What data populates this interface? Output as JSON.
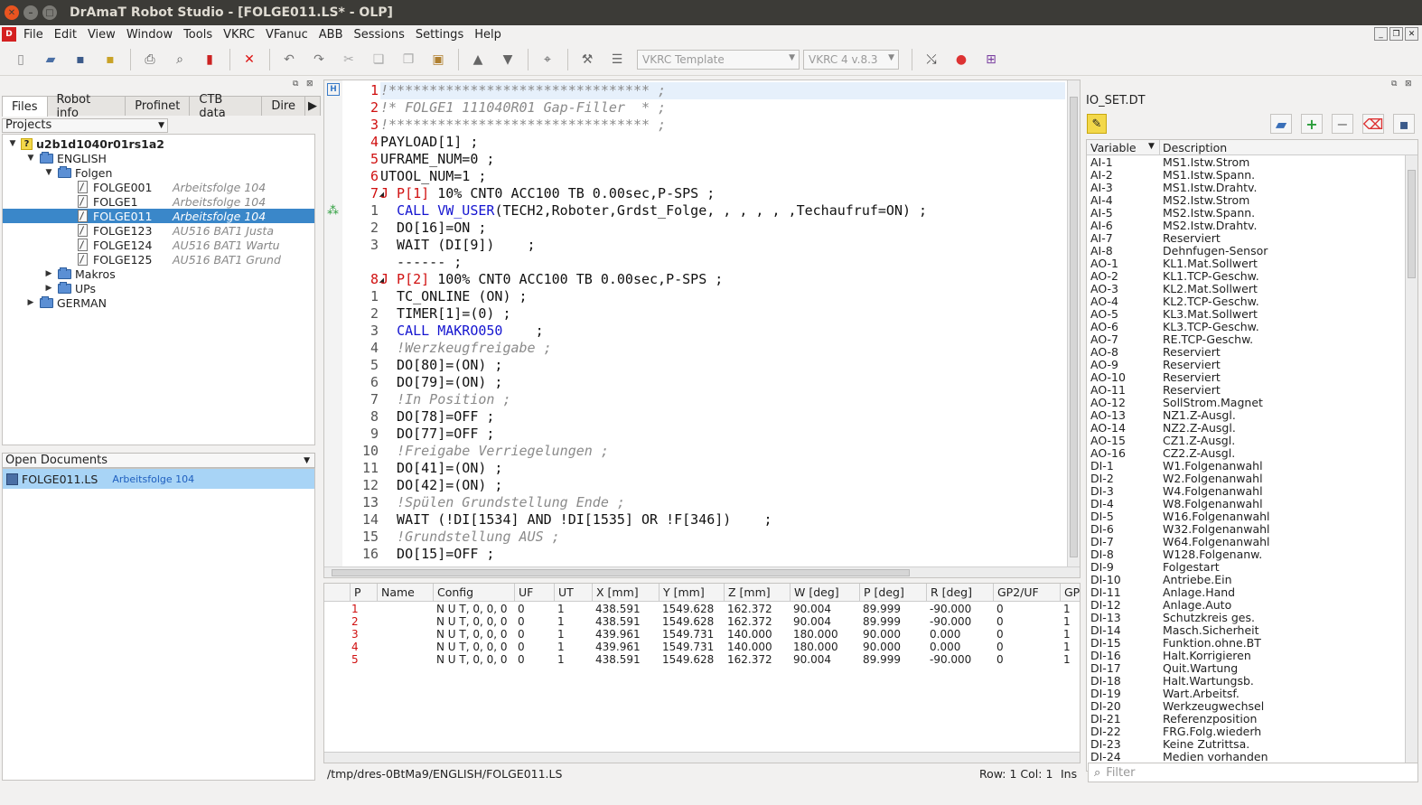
{
  "window": {
    "title": "DrAmaT Robot Studio - [FOLGE011.LS* - OLP]"
  },
  "menu": [
    "File",
    "Edit",
    "View",
    "Window",
    "Tools",
    "VKRC",
    "VFanuc",
    "ABB",
    "Sessions",
    "Settings",
    "Help"
  ],
  "toolbar": {
    "template_combo": "VKRC Template",
    "version_combo": "VKRC 4 v.8.3"
  },
  "left": {
    "tabs": [
      "Files",
      "Robot info",
      "Profinet",
      "CTB data",
      "Dire"
    ],
    "projects_label": "Projects",
    "tree": [
      {
        "label": "u2b1d1040r01rs1a2",
        "desc": "",
        "level": 0,
        "bold": true,
        "kind": "project",
        "expanded": true
      },
      {
        "label": "ENGLISH",
        "desc": "",
        "level": 1,
        "kind": "folder",
        "expanded": true
      },
      {
        "label": "Folgen",
        "desc": "",
        "level": 2,
        "kind": "folder",
        "expanded": true
      },
      {
        "label": "FOLGE001",
        "desc": "Arbeitsfolge 104",
        "level": 3,
        "kind": "file"
      },
      {
        "label": "FOLGE1",
        "desc": "Arbeitsfolge 104",
        "level": 3,
        "kind": "file"
      },
      {
        "label": "FOLGE011",
        "desc": "Arbeitsfolge 104",
        "level": 3,
        "kind": "file",
        "selected": true
      },
      {
        "label": "FOLGE123",
        "desc": "AU516 BAT1 Justa",
        "level": 3,
        "kind": "file"
      },
      {
        "label": "FOLGE124",
        "desc": "AU516 BAT1 Wartu",
        "level": 3,
        "kind": "file"
      },
      {
        "label": "FOLGE125",
        "desc": "AU516 BAT1 Grund",
        "level": 3,
        "kind": "file"
      },
      {
        "label": "Makros",
        "desc": "",
        "level": 2,
        "kind": "folder",
        "expanded": false
      },
      {
        "label": "UPs",
        "desc": "",
        "level": 2,
        "kind": "folder",
        "expanded": false
      },
      {
        "label": "GERMAN",
        "desc": "",
        "level": 1,
        "kind": "folder",
        "expanded": false
      }
    ],
    "open_documents_label": "Open Documents",
    "open_documents": [
      {
        "name": "FOLGE011.LS",
        "desc": "Arbeitsfolge 104"
      }
    ]
  },
  "editor": {
    "lines": [
      {
        "n": "1",
        "red": true,
        "parts": [
          {
            "t": "!******************************** ;",
            "c": "cmt"
          }
        ]
      },
      {
        "n": "2",
        "red": true,
        "parts": [
          {
            "t": "!* FOLGE1 111040R01 Gap-Filler  * ;",
            "c": "cmt"
          }
        ]
      },
      {
        "n": "3",
        "red": true,
        "parts": [
          {
            "t": "!******************************** ;",
            "c": "cmt"
          }
        ]
      },
      {
        "n": "4",
        "red": true,
        "parts": [
          {
            "t": "PAYLOAD[1] ;",
            "c": ""
          }
        ]
      },
      {
        "n": "5",
        "red": true,
        "parts": [
          {
            "t": "UFRAME_NUM=0 ;",
            "c": ""
          }
        ]
      },
      {
        "n": "6",
        "red": true,
        "parts": [
          {
            "t": "UTOOL_NUM=1 ;",
            "c": ""
          }
        ]
      },
      {
        "n": "7",
        "red": true,
        "fold": true,
        "parts": [
          {
            "t": "J P[1]",
            "c": "jmp"
          },
          {
            "t": " 10% CNT0 ACC100 TB 0.00sec,P-SPS ;",
            "c": ""
          }
        ]
      },
      {
        "n": "1",
        "red": false,
        "parts": [
          {
            "t": "  ",
            "c": ""
          },
          {
            "t": "CALL VW_USER",
            "c": "kw"
          },
          {
            "t": "(TECH2,Roboter,Grdst_Folge, , , , , ,Techaufruf=ON) ;",
            "c": ""
          }
        ]
      },
      {
        "n": "2",
        "red": false,
        "parts": [
          {
            "t": "  DO[16]=ON ;",
            "c": ""
          }
        ]
      },
      {
        "n": "3",
        "red": false,
        "parts": [
          {
            "t": "  WAIT (DI[9])    ;",
            "c": ""
          }
        ]
      },
      {
        "n": "",
        "red": false,
        "parts": [
          {
            "t": "  ------ ;",
            "c": ""
          }
        ]
      },
      {
        "n": "8",
        "red": true,
        "fold": true,
        "parts": [
          {
            "t": "J P[2]",
            "c": "jmp"
          },
          {
            "t": " 100% CNT0 ACC100 TB 0.00sec,P-SPS ;",
            "c": ""
          }
        ]
      },
      {
        "n": "1",
        "red": false,
        "parts": [
          {
            "t": "  TC_ONLINE (ON) ;",
            "c": ""
          }
        ]
      },
      {
        "n": "2",
        "red": false,
        "parts": [
          {
            "t": "  TIMER[1]=(0) ;",
            "c": ""
          }
        ]
      },
      {
        "n": "3",
        "red": false,
        "parts": [
          {
            "t": "  ",
            "c": ""
          },
          {
            "t": "CALL MAKRO050",
            "c": "kw"
          },
          {
            "t": "    ;",
            "c": ""
          }
        ]
      },
      {
        "n": "4",
        "red": false,
        "parts": [
          {
            "t": "  ",
            "c": ""
          },
          {
            "t": "!Werzkeugfreigabe ;",
            "c": "cmt"
          }
        ]
      },
      {
        "n": "5",
        "red": false,
        "parts": [
          {
            "t": "  DO[80]=(ON) ;",
            "c": ""
          }
        ]
      },
      {
        "n": "6",
        "red": false,
        "parts": [
          {
            "t": "  DO[79]=(ON) ;",
            "c": ""
          }
        ]
      },
      {
        "n": "7",
        "red": false,
        "parts": [
          {
            "t": "  ",
            "c": ""
          },
          {
            "t": "!In Position ;",
            "c": "cmt"
          }
        ]
      },
      {
        "n": "8",
        "red": false,
        "parts": [
          {
            "t": "  DO[78]=OFF ;",
            "c": ""
          }
        ]
      },
      {
        "n": "9",
        "red": false,
        "parts": [
          {
            "t": "  DO[77]=OFF ;",
            "c": ""
          }
        ]
      },
      {
        "n": "10",
        "red": false,
        "parts": [
          {
            "t": "  ",
            "c": ""
          },
          {
            "t": "!Freigabe Verriegelungen ;",
            "c": "cmt"
          }
        ]
      },
      {
        "n": "11",
        "red": false,
        "parts": [
          {
            "t": "  DO[41]=(ON) ;",
            "c": ""
          }
        ]
      },
      {
        "n": "12",
        "red": false,
        "parts": [
          {
            "t": "  DO[42]=(ON) ;",
            "c": ""
          }
        ]
      },
      {
        "n": "13",
        "red": false,
        "parts": [
          {
            "t": "  ",
            "c": ""
          },
          {
            "t": "!Spülen Grundstellung Ende ;",
            "c": "cmt"
          }
        ]
      },
      {
        "n": "14",
        "red": false,
        "parts": [
          {
            "t": "  WAIT (!DI[1534] AND !DI[1535] OR !F[346])    ;",
            "c": ""
          }
        ]
      },
      {
        "n": "15",
        "red": false,
        "parts": [
          {
            "t": "  ",
            "c": ""
          },
          {
            "t": "!Grundstellung AUS ;",
            "c": "cmt"
          }
        ]
      },
      {
        "n": "16",
        "red": false,
        "parts": [
          {
            "t": "  DO[15]=OFF ;",
            "c": ""
          }
        ]
      }
    ]
  },
  "points": {
    "columns": [
      "P",
      "Name",
      "Config",
      "UF",
      "UT",
      "X [mm]",
      "Y [mm]",
      "Z [mm]",
      "W [deg]",
      "P [deg]",
      "R [deg]",
      "GP2/UF",
      "GP2"
    ],
    "rows": [
      [
        "1",
        "",
        "N U T, 0, 0, 0",
        "0",
        "1",
        "438.591",
        "1549.628",
        "162.372",
        "90.004",
        "89.999",
        "-90.000",
        "0",
        "1"
      ],
      [
        "2",
        "",
        "N U T, 0, 0, 0",
        "0",
        "1",
        "438.591",
        "1549.628",
        "162.372",
        "90.004",
        "89.999",
        "-90.000",
        "0",
        "1"
      ],
      [
        "3",
        "",
        "N U T, 0, 0, 0",
        "0",
        "1",
        "439.961",
        "1549.731",
        "140.000",
        "180.000",
        "90.000",
        "0.000",
        "0",
        "1"
      ],
      [
        "4",
        "",
        "N U T, 0, 0, 0",
        "0",
        "1",
        "439.961",
        "1549.731",
        "140.000",
        "180.000",
        "90.000",
        "0.000",
        "0",
        "1"
      ],
      [
        "5",
        "",
        "N U T, 0, 0, 0",
        "0",
        "1",
        "438.591",
        "1549.628",
        "162.372",
        "90.004",
        "89.999",
        "-90.000",
        "0",
        "1"
      ]
    ]
  },
  "status": {
    "path": "/tmp/dres-0BtMa9/ENGLISH/FOLGE011.LS",
    "position": "Row: 1 Col: 1",
    "mode": "Ins"
  },
  "io": {
    "title": "IO_SET.DT",
    "col_variable": "Variable",
    "col_description": "Description",
    "filter_placeholder": "Filter",
    "rows": [
      [
        "AI-1",
        "MS1.Istw.Strom"
      ],
      [
        "AI-2",
        "MS1.Istw.Spann."
      ],
      [
        "AI-3",
        "MS1.Istw.Drahtv."
      ],
      [
        "AI-4",
        "MS2.Istw.Strom"
      ],
      [
        "AI-5",
        "MS2.Istw.Spann."
      ],
      [
        "AI-6",
        "MS2.Istw.Drahtv."
      ],
      [
        "AI-7",
        "Reserviert"
      ],
      [
        "AI-8",
        "Dehnfugen-Sensor"
      ],
      [
        "AO-1",
        "KL1.Mat.Sollwert"
      ],
      [
        "AO-2",
        "KL1.TCP-Geschw."
      ],
      [
        "AO-3",
        "KL2.Mat.Sollwert"
      ],
      [
        "AO-4",
        "KL2.TCP-Geschw."
      ],
      [
        "AO-5",
        "KL3.Mat.Sollwert"
      ],
      [
        "AO-6",
        "KL3.TCP-Geschw."
      ],
      [
        "AO-7",
        "RE.TCP-Geschw."
      ],
      [
        "AO-8",
        "Reserviert"
      ],
      [
        "AO-9",
        "Reserviert"
      ],
      [
        "AO-10",
        "Reserviert"
      ],
      [
        "AO-11",
        "Reserviert"
      ],
      [
        "AO-12",
        "SollStrom.Magnet"
      ],
      [
        "AO-13",
        "NZ1.Z-Ausgl."
      ],
      [
        "AO-14",
        "NZ2.Z-Ausgl."
      ],
      [
        "AO-15",
        "CZ1.Z-Ausgl."
      ],
      [
        "AO-16",
        "CZ2.Z-Ausgl."
      ],
      [
        "DI-1",
        "W1.Folgenanwahl"
      ],
      [
        "DI-2",
        "W2.Folgenanwahl"
      ],
      [
        "DI-3",
        "W4.Folgenanwahl"
      ],
      [
        "DI-4",
        "W8.Folgenanwahl"
      ],
      [
        "DI-5",
        "W16.Folgenanwahl"
      ],
      [
        "DI-6",
        "W32.Folgenanwahl"
      ],
      [
        "DI-7",
        "W64.Folgenanwahl"
      ],
      [
        "DI-8",
        "W128.Folgenanw."
      ],
      [
        "DI-9",
        "Folgestart"
      ],
      [
        "DI-10",
        "Antriebe.Ein"
      ],
      [
        "DI-11",
        "Anlage.Hand"
      ],
      [
        "DI-12",
        "Anlage.Auto"
      ],
      [
        "DI-13",
        "Schutzkreis ges."
      ],
      [
        "DI-14",
        "Masch.Sicherheit"
      ],
      [
        "DI-15",
        "Funktion.ohne.BT"
      ],
      [
        "DI-16",
        "Halt.Korrigieren"
      ],
      [
        "DI-17",
        "Quit.Wartung"
      ],
      [
        "DI-18",
        "Halt.Wartungsb."
      ],
      [
        "DI-19",
        "Wart.Arbeitsf."
      ],
      [
        "DI-20",
        "Werkzeugwechsel"
      ],
      [
        "DI-21",
        "Referenzposition"
      ],
      [
        "DI-22",
        "FRG.Folg.wiederh"
      ],
      [
        "DI-23",
        "Keine Zutrittsa."
      ],
      [
        "DI-24",
        "Medien vorhanden"
      ]
    ]
  },
  "colors": {
    "selection": "#3a87c9",
    "line_red": "#d01010",
    "keyword": "#1515d0",
    "comment": "#8a8a8a"
  }
}
